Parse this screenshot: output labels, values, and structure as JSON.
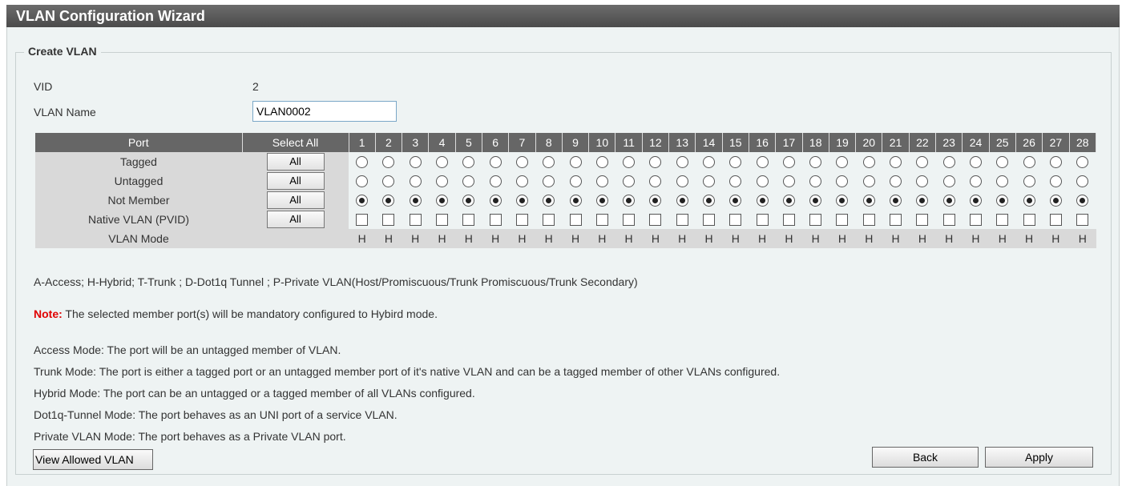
{
  "window": {
    "title": "VLAN Configuration Wizard"
  },
  "section": {
    "legend": "Create VLAN"
  },
  "vid": {
    "label": "VID",
    "value": "2"
  },
  "vlan_name": {
    "label": "VLAN Name",
    "value": "VLAN0002"
  },
  "table": {
    "port_header": "Port",
    "select_all_header": "Select All",
    "ports": [
      "1",
      "2",
      "3",
      "4",
      "5",
      "6",
      "7",
      "8",
      "9",
      "10",
      "11",
      "12",
      "13",
      "14",
      "15",
      "16",
      "17",
      "18",
      "19",
      "20",
      "21",
      "22",
      "23",
      "24",
      "25",
      "26",
      "27",
      "28"
    ],
    "rows": [
      {
        "label": "Tagged",
        "all_label": "All",
        "control": "radio",
        "selected": false
      },
      {
        "label": "Untagged",
        "all_label": "All",
        "control": "radio",
        "selected": false
      },
      {
        "label": "Not Member",
        "all_label": "All",
        "control": "radio",
        "selected": true
      },
      {
        "label": "Native VLAN (PVID)",
        "all_label": "All",
        "control": "checkbox",
        "selected": false
      }
    ],
    "mode_label": "VLAN Mode",
    "mode_value": "H"
  },
  "legend_text": "A-Access; H-Hybrid; T-Trunk ; D-Dot1q Tunnel ; P-Private VLAN(Host/Promiscuous/Trunk Promiscuous/Trunk Secondary)",
  "note": {
    "prefix": "Note:",
    "text": " The selected member port(s) will be mandatory configured to Hybird mode."
  },
  "descriptions": [
    "Access Mode: The port will be an untagged member of VLAN.",
    "Trunk Mode: The port is either a tagged port or an untagged member port of it's native VLAN and can be a tagged member of other VLANs configured.",
    "Hybrid Mode: The port can be an untagged or a tagged member of all VLANs configured.",
    "Dot1q-Tunnel Mode: The port behaves as an UNI port of a service VLAN.",
    "Private VLAN Mode: The port behaves as a Private VLAN port."
  ],
  "buttons": {
    "view_allowed": "View Allowed VLAN",
    "back": "Back",
    "apply": "Apply"
  },
  "colors": {
    "title_bar": "#555555",
    "panel_bg": "#eef3f3",
    "header_bg": "#666666",
    "note_red": "#e00000"
  }
}
